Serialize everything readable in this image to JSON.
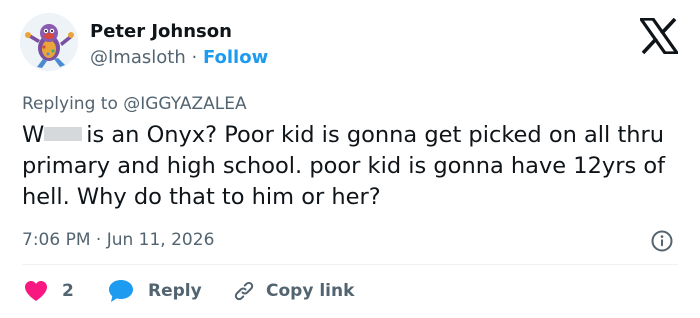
{
  "author": {
    "name": "Peter Johnson",
    "handle": "@Imasloth",
    "separator": "·",
    "follow_label": "Follow"
  },
  "reply": {
    "prefix": "Replying to",
    "target": "@IGGYAZALEA"
  },
  "tweet": {
    "text_start": "W",
    "text": "is an Onyx? Poor kid is gonna get picked on all thru primary and high school. poor kid is gonna have 12yrs of hell. Why do that to him or her?"
  },
  "timestamp": "7:06 PM · Jun 11, 2026",
  "actions": {
    "like_count": "2",
    "reply_label": "Reply",
    "copy_label": "Copy link"
  },
  "colors": {
    "accent": "#1d9bf0",
    "like": "#f91880",
    "muted": "#536471",
    "text": "#0f1419",
    "divider": "#eff3f4"
  },
  "icons": {
    "logo": "x-logo-icon",
    "info": "info-icon",
    "like": "heart-icon",
    "reply": "speech-bubble-icon",
    "copy": "link-icon"
  }
}
